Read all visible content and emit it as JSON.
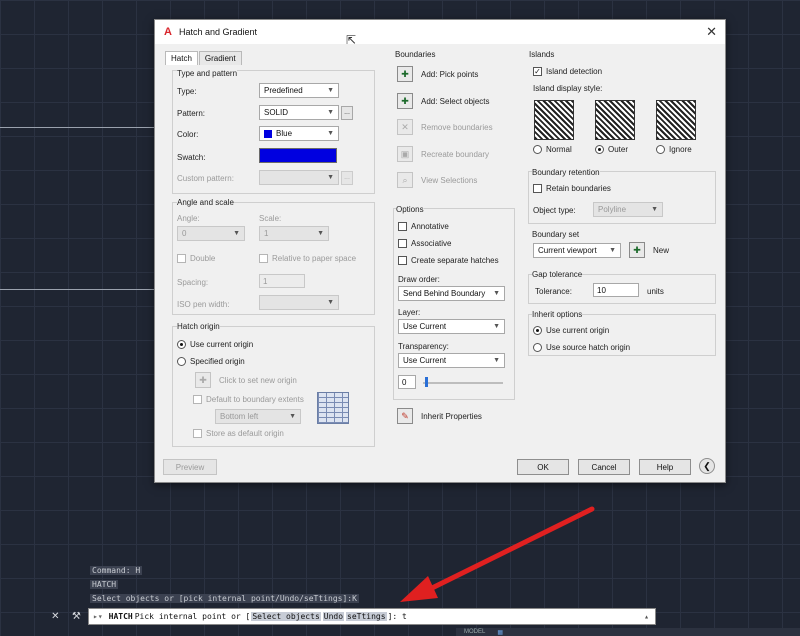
{
  "dialog": {
    "title": "Hatch and Gradient",
    "close": "✕",
    "tabs": [
      "Hatch",
      "Gradient"
    ],
    "type_pattern": {
      "title": "Type and pattern",
      "type_label": "Type:",
      "type_value": "Predefined",
      "pattern_label": "Pattern:",
      "pattern_value": "SOLID",
      "color_label": "Color:",
      "color_value": "Blue",
      "swatch_label": "Swatch:",
      "custom_label": "Custom pattern:",
      "swatch_color": "#0000e0"
    },
    "angle_scale": {
      "title": "Angle and scale",
      "angle_label": "Angle:",
      "angle_value": "0",
      "scale_label": "Scale:",
      "scale_value": "1",
      "double_label": "Double",
      "relative_label": "Relative to paper space",
      "spacing_label": "Spacing:",
      "spacing_value": "1",
      "iso_label": "ISO pen width:"
    },
    "hatch_origin": {
      "title": "Hatch origin",
      "use_current": "Use current origin",
      "specified": "Specified origin",
      "click_set": "Click to set new origin",
      "default_extents": "Default to boundary extents",
      "bottom_left": "Bottom left",
      "store_default": "Store as default origin"
    },
    "boundaries": {
      "title": "Boundaries",
      "add_pick": "Add: Pick points",
      "add_select": "Add: Select objects",
      "remove": "Remove boundaries",
      "recreate": "Recreate boundary",
      "view": "View Selections"
    },
    "options": {
      "title": "Options",
      "annotative": "Annotative",
      "associative": "Associative",
      "separate": "Create separate hatches",
      "draw_order_label": "Draw order:",
      "draw_order_value": "Send Behind Boundary",
      "layer_label": "Layer:",
      "layer_value": "Use Current",
      "transparency_label": "Transparency:",
      "transparency_value": "Use Current",
      "transparency_num": "0",
      "inherit": "Inherit Properties"
    },
    "islands": {
      "title": "Islands",
      "detection": "Island detection",
      "style_label": "Island display style:",
      "normal": "Normal",
      "outer": "Outer",
      "ignore": "Ignore"
    },
    "boundary_retention": {
      "title": "Boundary retention",
      "retain": "Retain boundaries",
      "object_type_label": "Object type:",
      "object_type_value": "Polyline"
    },
    "boundary_set": {
      "title": "Boundary set",
      "value": "Current viewport",
      "new": "New"
    },
    "gap": {
      "title": "Gap tolerance",
      "label": "Tolerance:",
      "value": "10",
      "units": "units"
    },
    "inherit_options": {
      "title": "Inherit options",
      "use_current": "Use current origin",
      "use_source": "Use source hatch origin"
    },
    "buttons": {
      "preview": "Preview",
      "ok": "OK",
      "cancel": "Cancel",
      "help": "Help"
    }
  },
  "command": {
    "history": [
      "Command: H",
      "HATCH",
      "Select objects or [pick internal point/Undo/seTtings]:K"
    ],
    "prompt_cmd": "HATCH",
    "prompt_text": "Pick internal point or [",
    "opt1": "Select objects",
    "opt2": "Undo",
    "opt3": "seTtings",
    "prompt_end": "]: t"
  },
  "status_bar": {
    "model": "MODEL"
  },
  "colors": {
    "arrow": "#e02020",
    "accent_blue": "#0000e0"
  }
}
